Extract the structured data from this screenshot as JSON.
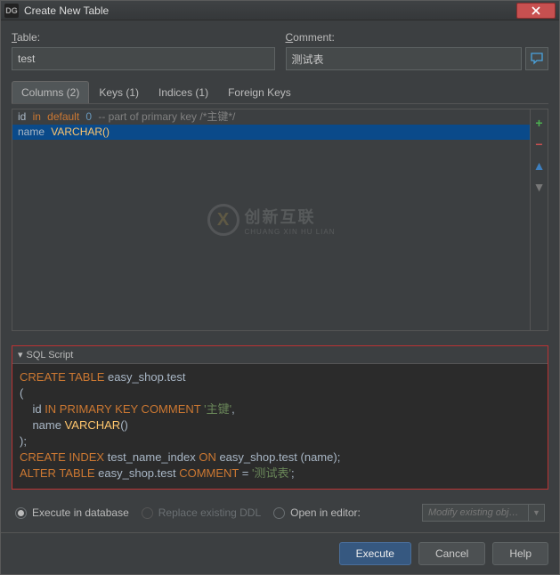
{
  "window": {
    "title": "Create New Table",
    "logo": "DG"
  },
  "fields": {
    "table_label": "Table:",
    "table_value": "test",
    "comment_label_prefix": "C",
    "comment_label_rest": "omment:",
    "comment_value": "测试表"
  },
  "tabs": [
    {
      "label": "Columns (2)",
      "active": true
    },
    {
      "label": "Keys (1)",
      "active": false
    },
    {
      "label": "Indices (1)",
      "active": false
    },
    {
      "label": "Foreign Keys",
      "active": false
    }
  ],
  "rows": {
    "r0": {
      "name": "id",
      "type": "in",
      "kw": "default",
      "val": "0",
      "comment": "-- part of primary key /*主键*/"
    },
    "r1": {
      "name": "name",
      "type": "VARCHAR()"
    }
  },
  "watermark": {
    "icon": "X",
    "big": "创新互联",
    "small": "CHUANG XIN HU LIAN"
  },
  "sql": {
    "header": "SQL Script",
    "lines": {
      "l0": {
        "kw": "CREATE TABLE",
        "id": " easy_shop.test"
      },
      "l1": "(",
      "l2": {
        "indent": "    ",
        "id": "id ",
        "kw": "IN PRIMARY KEY COMMENT",
        "str": " '主键'",
        "tail": ","
      },
      "l3": {
        "indent": "    ",
        "id": "name ",
        "fn": "VARCHAR",
        "tail": "()"
      },
      "l4": ");",
      "l5": {
        "kw": "CREATE INDEX",
        "id1": " test_name_index ",
        "kw2": "ON",
        "id2": " easy_shop.test (name)",
        "tail": ";"
      },
      "l6": {
        "kw": "ALTER TABLE",
        "id": " easy_shop.test ",
        "kw2": "COMMENT",
        "eq": " = ",
        "str": "'测试表'",
        "tail": ";"
      }
    }
  },
  "radios": {
    "r0": "Execute in database",
    "r1": "Replace existing DDL",
    "r2": "Open in editor:",
    "combo": "Modify existing obj…"
  },
  "buttons": {
    "execute": "Execute",
    "cancel": "Cancel",
    "help": "Help"
  }
}
